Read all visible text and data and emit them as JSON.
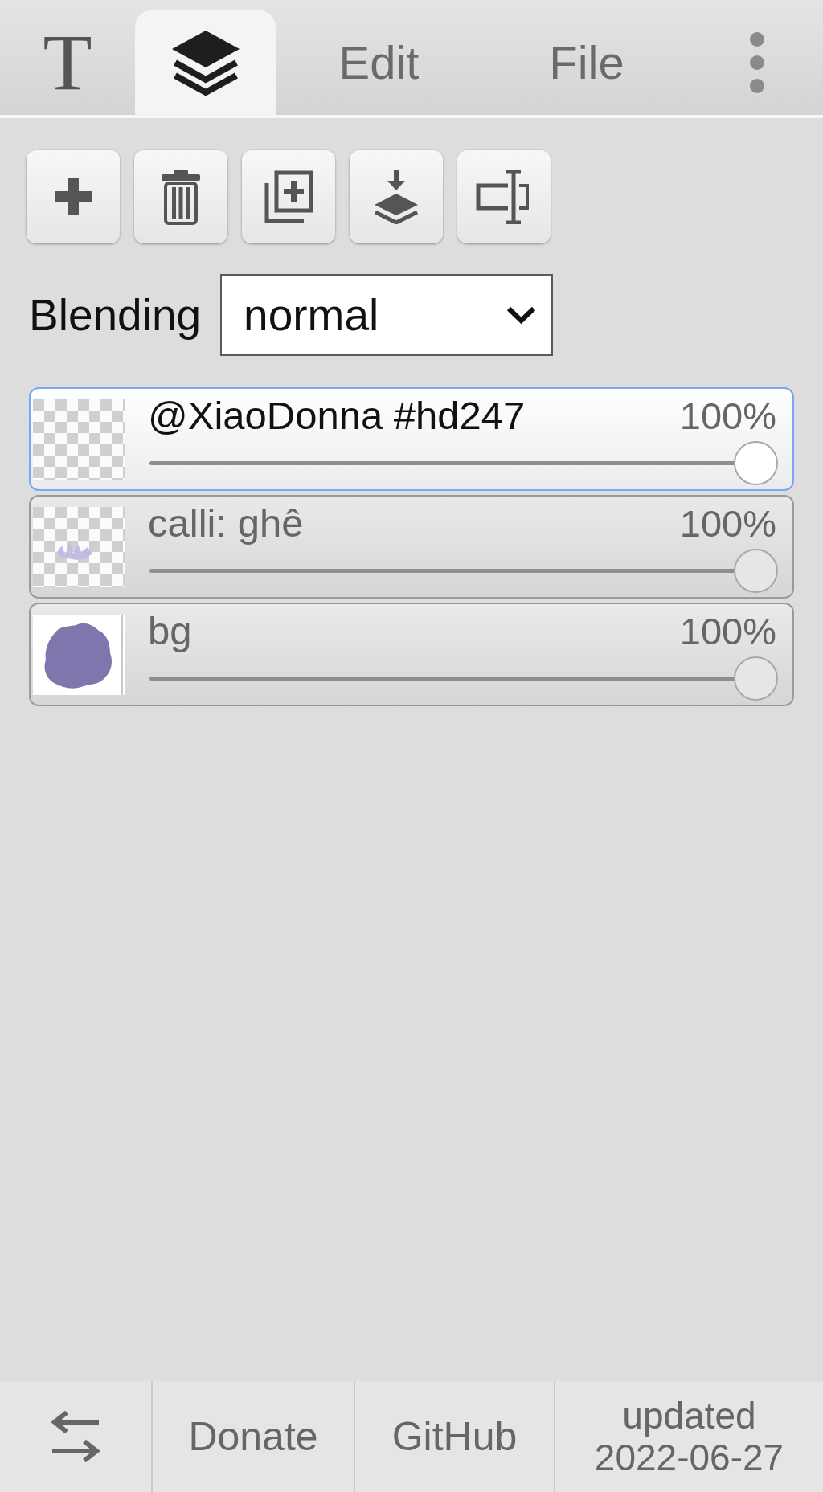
{
  "tabs": [
    {
      "kind": "glyph",
      "label": "T",
      "selected": false
    },
    {
      "kind": "icon",
      "selected": true
    },
    {
      "kind": "text",
      "label": "Edit",
      "selected": false
    },
    {
      "kind": "text",
      "label": "File",
      "selected": false
    }
  ],
  "blending": {
    "label": "Blending",
    "value": "normal"
  },
  "layers": [
    {
      "name": "@XiaoDonna #hd247",
      "opacity": "100%",
      "level": 1,
      "selected": true,
      "kind": "empty"
    },
    {
      "name": "calli: ghê",
      "opacity": "100%",
      "level": 1,
      "selected": false,
      "kind": "sketch"
    },
    {
      "name": "bg",
      "opacity": "100%",
      "level": 1,
      "selected": false,
      "kind": "fill"
    }
  ],
  "footer": {
    "links": [
      {
        "label": "Donate"
      },
      {
        "label": "GitHub"
      }
    ],
    "updated": "updated 2022-06-27"
  }
}
